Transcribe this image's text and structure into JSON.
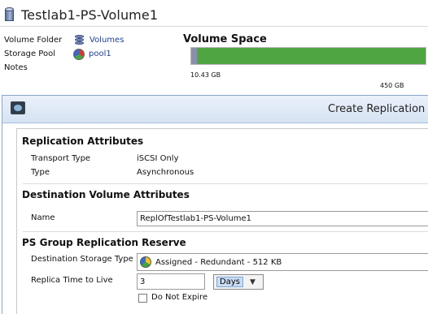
{
  "volume": {
    "title": "Testlab1-PS-Volume1",
    "properties": {
      "folder_label": "Volume Folder",
      "folder_value": "Volumes",
      "pool_label": "Storage Pool",
      "pool_value": "pool1",
      "notes_label": "Notes"
    },
    "space": {
      "title": "Volume Space",
      "used_label": "10.43 GB",
      "total_label": "450 GB",
      "used_fraction": 0.023,
      "used_color": "#8a8fb0",
      "free_color": "#4fa542"
    }
  },
  "dialog": {
    "title": "Create Replication",
    "replication_attributes": {
      "heading": "Replication Attributes",
      "transport_label": "Transport Type",
      "transport_value": "iSCSI Only",
      "type_label": "Type",
      "type_value": "Asynchronous"
    },
    "destination_volume": {
      "heading": "Destination Volume Attributes",
      "name_label": "Name",
      "name_value": "ReplOfTestlab1-PS-Volume1"
    },
    "reserve": {
      "heading": "PS Group Replication Reserve",
      "storage_type_label": "Destination Storage Type",
      "storage_type_value": "Assigned - Redundant - 512 KB",
      "ttl_label": "Replica Time to Live",
      "ttl_value": "3",
      "ttl_unit": "Days",
      "do_not_expire_label": "Do Not Expire"
    }
  },
  "icons": [
    "volume-icon",
    "folder-icon",
    "pool-icon",
    "app-icon",
    "storage-type-icon",
    "chevron-down-icon"
  ]
}
